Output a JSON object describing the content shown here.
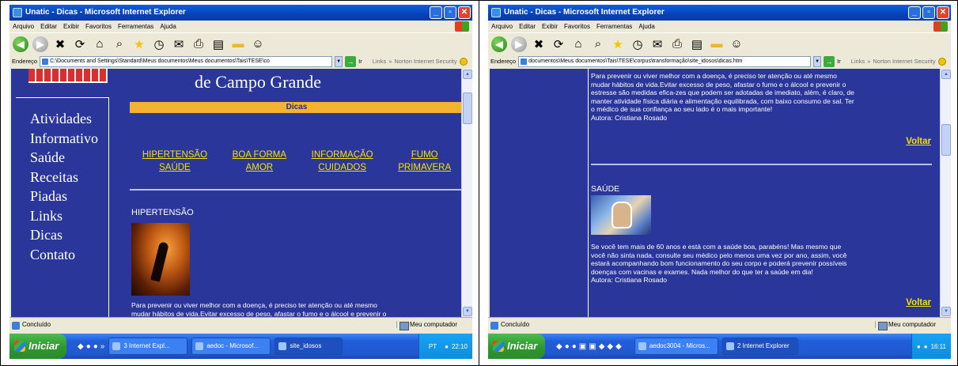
{
  "left": {
    "window_title": "Unatic - Dicas - Microsoft Internet Explorer",
    "menu": [
      "Arquivo",
      "Editar",
      "Exibir",
      "Favoritos",
      "Ferramentas",
      "Ajuda"
    ],
    "address_label": "Endereço",
    "address_value": "C:\\Documents and Settings\\Standard\\Meus documentos\\Meus documentos\\Tais\\TESE\\co",
    "go_label": "Ir",
    "links_label": "Links",
    "norton_label": "Norton Internet Security",
    "site_title": "de Campo Grande",
    "nav": [
      "Atividades",
      "Informativo",
      "Saúde",
      "Receitas",
      "Piadas",
      "Links",
      "Dicas",
      "Contato"
    ],
    "dicas_label": "Dicas",
    "links": [
      {
        "line1": "HIPERTENSÃO",
        "line2": "SAÚDE"
      },
      {
        "line1": "BOA FORMA",
        "line2": "AMOR"
      },
      {
        "line1": "INFORMAÇÃO",
        "line2": "CUIDADOS"
      },
      {
        "line1": "FUMO",
        "line2": "PRIMAVERA"
      }
    ],
    "section_title": "HIPERTENSÃO",
    "paragraph_line1": "Para prevenir ou viver melhor com a doença, é preciso ter atenção ou até mesmo",
    "paragraph_line2": "mudar hábitos de vida.Evitar excesso de peso, afastar o fumo e o álcool e prevenir o",
    "status_text": "Concluído",
    "status_zone": "Meu computador",
    "start_label": "Iniciar",
    "tasks": [
      "3 Internet Expl...",
      "aedoc - Microsof...",
      "site_idosos"
    ],
    "lang": "PT",
    "clock": "22:10"
  },
  "right": {
    "window_title": "Unatic - Dicas - Microsoft Internet Explorer",
    "menu": [
      "Arquivo",
      "Editar",
      "Exibir",
      "Favoritos",
      "Ferramentas",
      "Ajuda"
    ],
    "address_label": "Endereço",
    "address_value": "documentos\\Meus documentos\\Tais\\TESE\\corpus\\transformação\\site_idosos\\dicas.htm",
    "go_label": "Ir",
    "links_label": "Links",
    "norton_label": "Norton Internet Security",
    "paragraph1": [
      "Para prevenir ou viver melhor com a doença, é preciso ter atenção ou até mesmo",
      "mudar hábitos de vida.Evitar excesso de peso, afastar o fumo e o álcool e prevenir o",
      "estresse são medidas efica-zes que podem ser adotadas de imediato, além, é claro, de",
      "manter atividade física diária e alimentação equilibrada, com baixo consumo de sal. Ter",
      "o médico de sua confiança ao seu lado é o mais importante!",
      "Autora: Cristiana Rosado"
    ],
    "voltar": "Voltar",
    "section_title": "SAÚDE",
    "paragraph2": [
      "Se você tem mais de 60 anos e está com a saúde boa, parabéns! Mas mesmo que",
      "você não sinta nada, consulte seu médico pelo menos  uma vez por ano,  assim, você",
      "estará acompanhando bom funcionamento do seu corpo e poderá prevenir possíveis",
      "doenças com vacinas e exames. Nada melhor do que ter a saúde em dia!",
      "Autora: Cristiana Rosado"
    ],
    "voltar2": "Voltar",
    "status_text": "Concluído",
    "status_zone": "Meu computador",
    "start_label": "Iniciar",
    "tasks": [
      "aedoc3004 - Micros...",
      "2 Internet Explorer"
    ],
    "clock": "16:11"
  }
}
